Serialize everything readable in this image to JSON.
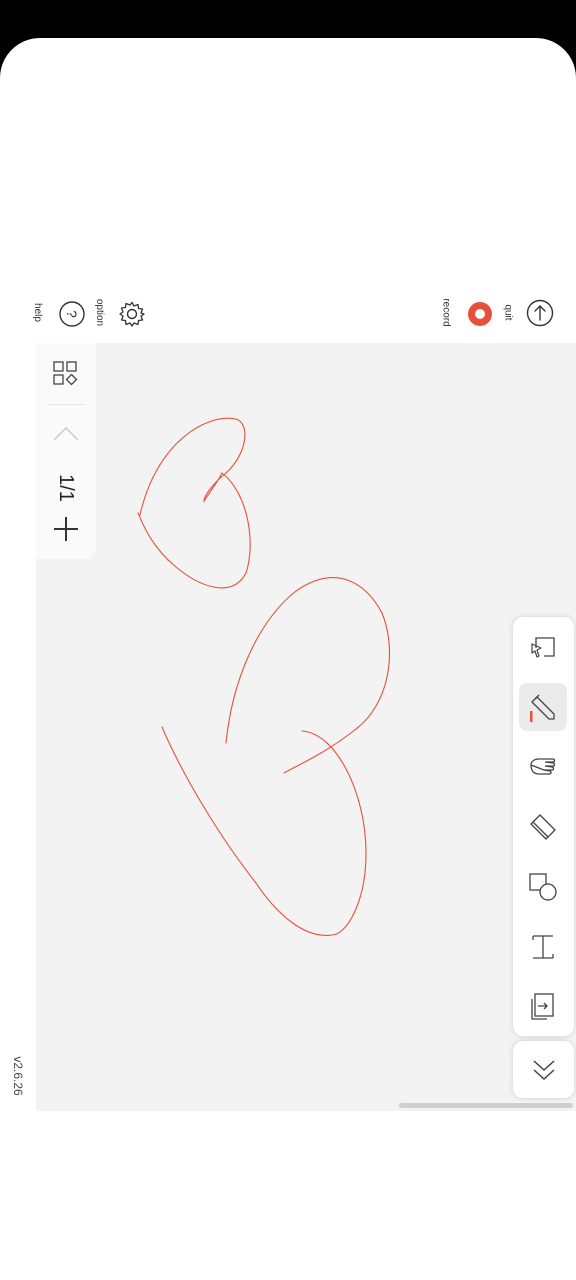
{
  "header": {
    "help_label": "help",
    "option_label": "option",
    "record_label": "record",
    "quit_label": "quit"
  },
  "pages": {
    "indicator": "1/1"
  },
  "toolbar": {
    "tools": [
      "select",
      "pen",
      "hand",
      "eraser",
      "shape",
      "text",
      "import"
    ],
    "active_tool": "pen",
    "pen_color": "#e8503a"
  },
  "footer": {
    "version": "v2.6.26"
  },
  "colors": {
    "accent_record": "#e8503a",
    "canvas_bg": "#f3f3f3",
    "stroke": "#e8503a"
  }
}
